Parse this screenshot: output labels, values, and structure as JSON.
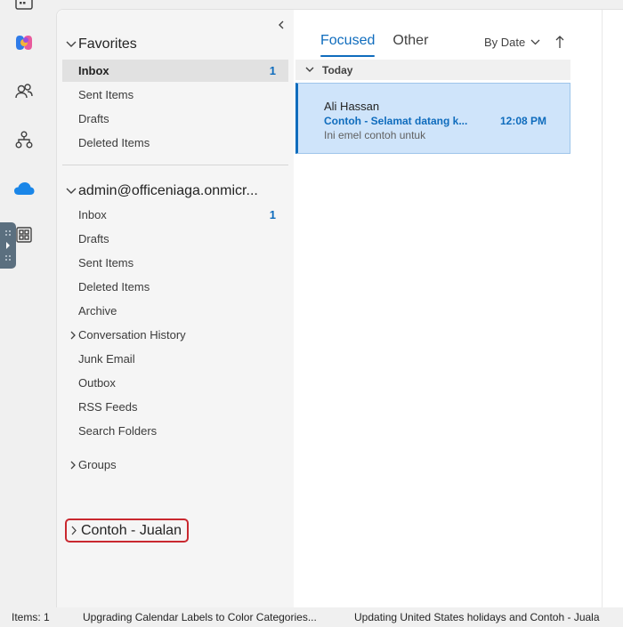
{
  "nav": {
    "favorites_label": "Favorites",
    "favorites": [
      {
        "label": "Inbox",
        "count": "1"
      },
      {
        "label": "Sent Items"
      },
      {
        "label": "Drafts"
      },
      {
        "label": "Deleted Items"
      }
    ],
    "account_label": "admin@officeniaga.onmicr...",
    "account_folders": [
      {
        "label": "Inbox",
        "count": "1"
      },
      {
        "label": "Drafts"
      },
      {
        "label": "Sent Items"
      },
      {
        "label": "Deleted Items"
      },
      {
        "label": "Archive"
      },
      {
        "label": "Conversation History"
      },
      {
        "label": "Junk Email"
      },
      {
        "label": "Outbox"
      },
      {
        "label": "RSS Feeds"
      },
      {
        "label": "Search Folders"
      }
    ],
    "groups_label": "Groups",
    "highlighted_label": "Contoh - Jualan"
  },
  "list": {
    "tabs": [
      "Focused",
      "Other"
    ],
    "sort_label": "By Date",
    "group_label": "Today",
    "messages": [
      {
        "sender": "Ali Hassan",
        "subject": "Contoh - Selamat datang k...",
        "time": "12:08 PM",
        "preview": "Ini emel contoh untuk"
      }
    ]
  },
  "status": {
    "items": "Items: 1",
    "reminder1": "Upgrading Calendar Labels to Color Categories...",
    "reminder2": "Updating United States holidays and Contoh - Juala"
  },
  "colors": {
    "accent": "#0f6cbd",
    "selected_message_bg": "#cfe4fa",
    "highlight_border": "#c9282f"
  },
  "icons": [
    "calendar-icon",
    "copilot-icon",
    "people-icon",
    "org-chart-icon",
    "onedrive-icon",
    "apps-icon"
  ]
}
